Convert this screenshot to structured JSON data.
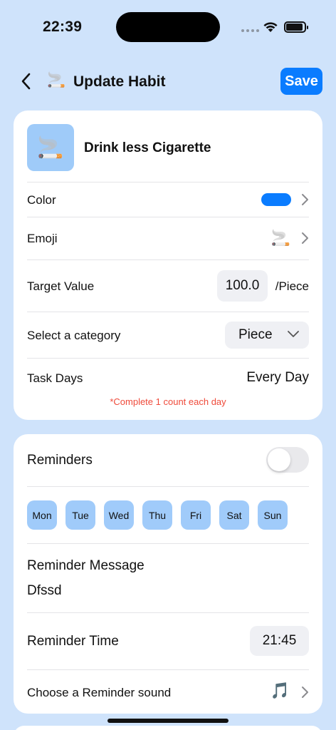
{
  "status_bar": {
    "time": "22:39"
  },
  "nav": {
    "emoji": "🚬",
    "title": "Update Habit",
    "save_label": "Save"
  },
  "habit": {
    "icon_emoji": "🚬",
    "name": "Drink less Cigarette"
  },
  "settings": {
    "color_label": "Color",
    "color_value": "#0a7cff",
    "emoji_label": "Emoji",
    "emoji_value": "🚬",
    "target_label": "Target Value",
    "target_value": "100.0",
    "target_unit": "/Piece",
    "category_label": "Select a category",
    "category_value": "Piece",
    "task_days_label": "Task Days",
    "task_days_value": "Every Day",
    "task_note": "*Complete 1 count each day"
  },
  "reminders": {
    "label": "Reminders",
    "enabled": false,
    "days": [
      "Mon",
      "Tue",
      "Wed",
      "Thu",
      "Fri",
      "Sat",
      "Sun"
    ],
    "message_label": "Reminder Message",
    "message_value": "Dfssd",
    "time_label": "Reminder Time",
    "time_value": "21:45",
    "sound_label": "Choose a Reminder sound",
    "sound_icon": "🎵"
  },
  "colors": {
    "accent": "#0a7cff",
    "background": "#cfe3fb",
    "day_chip": "#a0cbfa",
    "note": "#ef4a3a"
  }
}
